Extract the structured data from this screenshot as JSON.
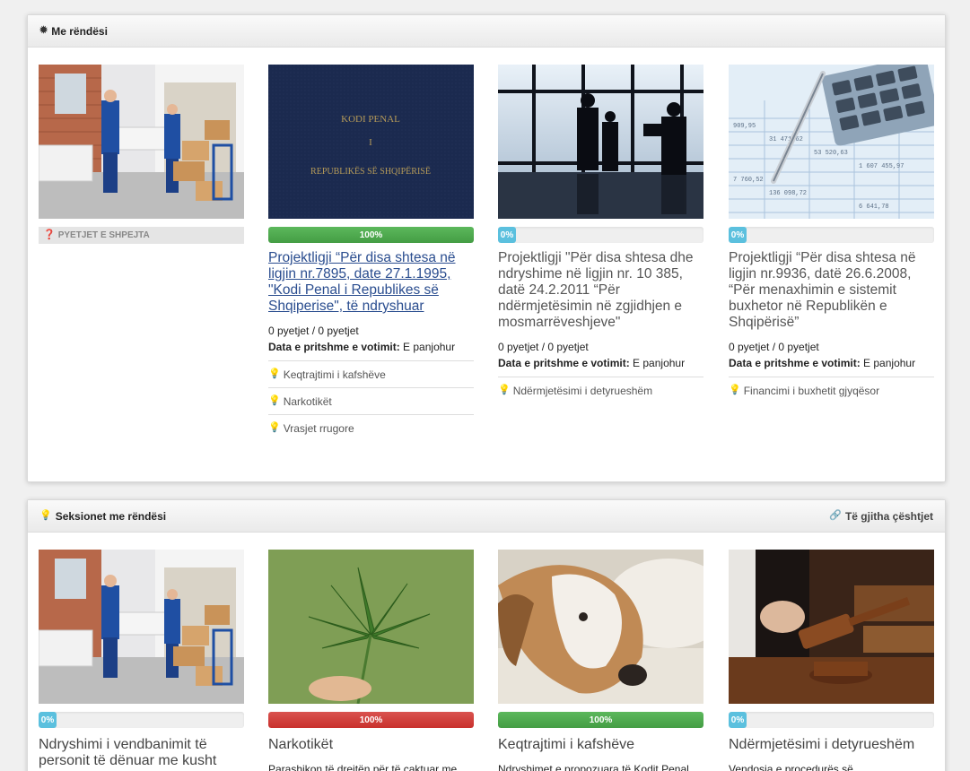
{
  "panel_featured": {
    "title": "Me rëndësi",
    "icon": "gear-icon",
    "items": [
      {
        "image": "movers-icon",
        "quick_label": "PYETJET E SHPEJTA"
      },
      {
        "image": "book-icon",
        "book_text_1": "KODI PENAL",
        "book_text_2": "I",
        "book_text_3": "REPUBLIKËS SË SHQIPËRISË",
        "progress": 100,
        "progress_label": "100%",
        "title": "Projektligji “Për disa shtesa në ligjin nr.7895, date 27.1.1995, \"Kodi Penal i Republikes së Shqiperise\", të ndryshuar",
        "questions": "0 pyetjet / 0 pyetjet",
        "vote_label": "Data e pritshme e votimit:",
        "vote_value": "E panjohur",
        "tags": [
          "Keqtrajtimi i kafshëve",
          "Narkotikët",
          "Vrasjet rrugore"
        ]
      },
      {
        "image": "meeting-icon",
        "progress": 0,
        "progress_label": "0%",
        "title": "Projektligji \"Për disa shtesa dhe ndryshime në ligjin nr. 10 385, datë 24.2.2011 “Për ndërmjetësimin në zgjidhjen e mosmarrëveshjeve\"",
        "questions": "0 pyetjet / 0 pyetjet",
        "vote_label": "Data e pritshme e votimit:",
        "vote_value": "E panjohur",
        "tags": [
          "Ndërmjetësimi i detyrueshëm"
        ]
      },
      {
        "image": "calculator-icon",
        "progress": 0,
        "progress_label": "0%",
        "title": "Projektligji “Për disa shtesa në ligjin nr.9936, datë 26.6.2008, “Për menaxhimin e sistemit buxhetor në Republikën e Shqipërisë”",
        "questions": "0 pyetjet / 0 pyetjet",
        "vote_label": "Data e pritshme e votimit:",
        "vote_value": "E panjohur",
        "tags": [
          "Financimi i buxhetit gjyqësor"
        ]
      }
    ]
  },
  "panel_sections": {
    "title": "Seksionet me rëndësi",
    "icon": "lightbulb-icon",
    "all_link": "Të gjitha çështjet",
    "items": [
      {
        "image": "movers-icon",
        "progress": 0,
        "progress_label": "0%",
        "color": "blue",
        "title": "Ndryshimi i vendbanimit të personit të dënuar me kusht",
        "desc": ""
      },
      {
        "image": "cannabis-icon",
        "progress": 100,
        "progress_label": "100%",
        "color": "red",
        "title": "Narkotikët",
        "desc": "Parashikon të drejtën për të caktuar me"
      },
      {
        "image": "dog-icon",
        "progress": 100,
        "progress_label": "100%",
        "color": "green",
        "title": "Keqtrajtimi i kafshëve",
        "desc": "Ndryshimet e propozuara të Kodit Penal"
      },
      {
        "image": "gavel-icon",
        "progress": 0,
        "progress_label": "0%",
        "color": "blue",
        "title": "Ndërmjetësimi i detyrueshëm",
        "desc": "Vendosja e procedurës së"
      }
    ]
  }
}
